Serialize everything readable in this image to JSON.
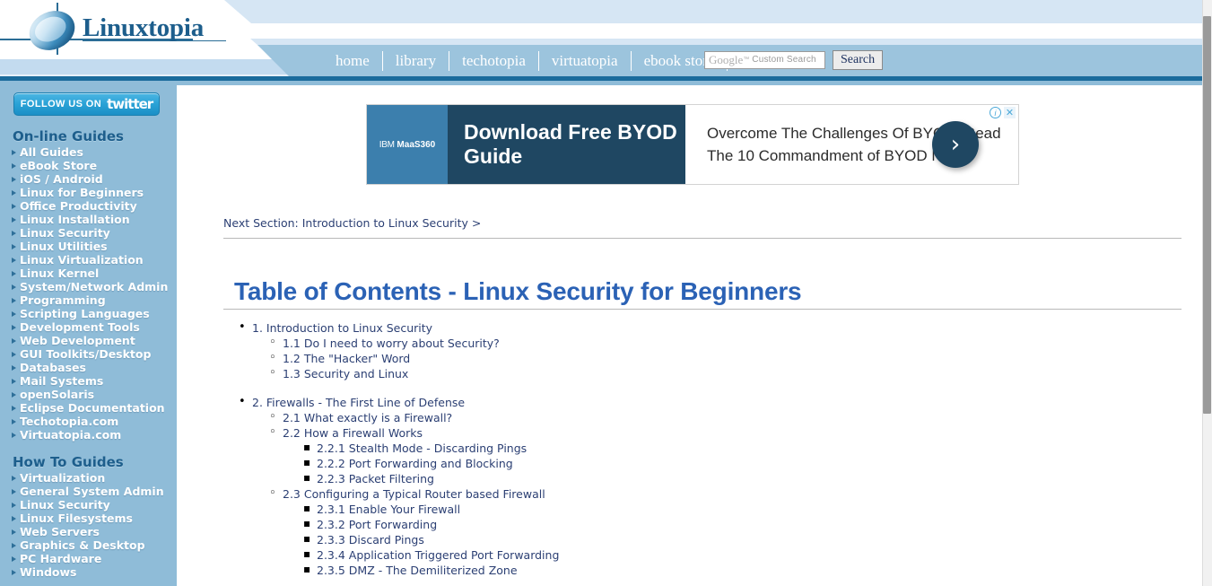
{
  "site": {
    "logo_text": "Linuxtopia"
  },
  "nav": {
    "items": [
      {
        "label": "home"
      },
      {
        "label": "library"
      },
      {
        "label": "techotopia"
      },
      {
        "label": "virtuatopia"
      },
      {
        "label": "ebook store"
      }
    ]
  },
  "search": {
    "brand": "Google",
    "tm": "™",
    "placeholder": "Custom Search",
    "button_label": "Search"
  },
  "sidebar": {
    "twitter": {
      "label": "FOLLOW US ON",
      "brand": "twitter"
    },
    "groups": [
      {
        "heading": "On-line Guides",
        "items": [
          {
            "label": "All Guides"
          },
          {
            "label": "eBook Store"
          },
          {
            "label": "iOS / Android"
          },
          {
            "label": "Linux for Beginners"
          },
          {
            "label": "Office Productivity"
          },
          {
            "label": "Linux Installation"
          },
          {
            "label": "Linux Security"
          },
          {
            "label": "Linux Utilities"
          },
          {
            "label": "Linux Virtualization"
          },
          {
            "label": "Linux Kernel"
          },
          {
            "label": "System/Network Admin"
          },
          {
            "label": "Programming"
          },
          {
            "label": "Scripting Languages"
          },
          {
            "label": "Development Tools"
          },
          {
            "label": "Web Development"
          },
          {
            "label": "GUI Toolkits/Desktop"
          },
          {
            "label": "Databases"
          },
          {
            "label": "Mail Systems"
          },
          {
            "label": "openSolaris"
          },
          {
            "label": "Eclipse Documentation"
          },
          {
            "label": "Techotopia.com"
          },
          {
            "label": "Virtuatopia.com"
          }
        ]
      },
      {
        "heading": "How To Guides",
        "items": [
          {
            "label": "Virtualization"
          },
          {
            "label": "General System Admin"
          },
          {
            "label": "Linux Security"
          },
          {
            "label": "Linux Filesystems"
          },
          {
            "label": "Web Servers"
          },
          {
            "label": "Graphics & Desktop"
          },
          {
            "label": "PC Hardware"
          },
          {
            "label": "Windows"
          }
        ]
      }
    ]
  },
  "ad": {
    "sponsor": "IBM MaaS360",
    "sponsor_ibm": "IBM",
    "sponsor_maas": "MaaS360",
    "headline": "Download Free BYOD Guide",
    "body": "Overcome The Challenges Of BYOD. Read The 10 Commandment of BYOD Now",
    "arrow_glyph": "›",
    "info_glyph": "i",
    "close_glyph": "✕"
  },
  "main": {
    "next_section": "Next Section: Introduction to Linux Security >",
    "title": "Table of Contents - Linux Security for Beginners",
    "toc": [
      {
        "level": 1,
        "label": "1. Introduction to Linux Security"
      },
      {
        "level": 2,
        "label": "1.1 Do I need to worry about Security?"
      },
      {
        "level": 2,
        "label": "1.2 The \"Hacker\" Word"
      },
      {
        "level": 2,
        "label": "1.3 Security and Linux"
      },
      {
        "level": 0,
        "label": ""
      },
      {
        "level": 1,
        "label": "2. Firewalls - The First Line of Defense"
      },
      {
        "level": 2,
        "label": "2.1 What exactly is a Firewall?"
      },
      {
        "level": 2,
        "label": "2.2 How a Firewall Works"
      },
      {
        "level": 3,
        "label": "2.2.1 Stealth Mode - Discarding Pings"
      },
      {
        "level": 3,
        "label": "2.2.2 Port Forwarding and Blocking"
      },
      {
        "level": 3,
        "label": "2.2.3 Packet Filtering"
      },
      {
        "level": 2,
        "label": "2.3 Configuring a Typical Router based Firewall"
      },
      {
        "level": 3,
        "label": "2.3.1 Enable Your Firewall"
      },
      {
        "level": 3,
        "label": "2.3.2 Port Forwarding"
      },
      {
        "level": 3,
        "label": "2.3.3 Discard Pings"
      },
      {
        "level": 3,
        "label": "2.3.4 Application Triggered Port Forwarding"
      },
      {
        "level": 3,
        "label": "2.3.5 DMZ - The Demiliterized Zone"
      }
    ]
  },
  "colors": {
    "header_rule": "#1a6b9c",
    "sidebar_bg": "#8fbcd8",
    "nav_bg": "#9cc4dd",
    "title_blue": "#2b62b5",
    "link_navy": "#2b3f73",
    "ad_dark": "#1f4762",
    "ad_logo_bg": "#3c7fad"
  }
}
